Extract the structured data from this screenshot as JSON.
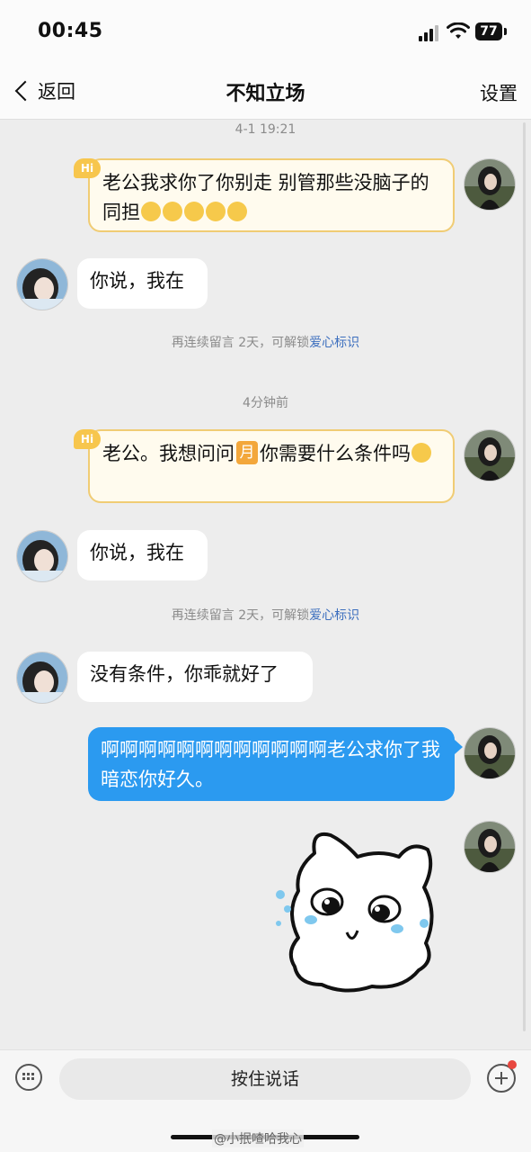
{
  "status_bar": {
    "time": "00:45",
    "battery": "77"
  },
  "navbar": {
    "back_label": "返回",
    "title": "不知立场",
    "settings_label": "设置"
  },
  "messages": [
    {
      "kind": "timestamp",
      "text": "4-1 19:21"
    },
    {
      "kind": "sent_hi",
      "text": "老公我求你了你别走 别管那些没脑子的同担",
      "emoji_count": 5,
      "hi": "Hi"
    },
    {
      "kind": "received",
      "text": "你说，我在"
    },
    {
      "kind": "notice",
      "prefix": "再连续留言 2天，可解锁",
      "link": "爱心标识"
    },
    {
      "kind": "timestamp",
      "text": "4分钟前"
    },
    {
      "kind": "sent_hi",
      "text_before": "老公。我想问问",
      "inline_badge": "月",
      "text_after": "你需要什么条件吗",
      "hi": "Hi"
    },
    {
      "kind": "received",
      "text": "你说，我在"
    },
    {
      "kind": "notice",
      "prefix": "再连续留言 2天，可解锁",
      "link": "爱心标识"
    },
    {
      "kind": "received",
      "text": "没有条件，你乖就好了"
    },
    {
      "kind": "sent",
      "text": "啊啊啊啊啊啊啊啊啊啊啊啊老公求你了我暗恋你好久。"
    },
    {
      "kind": "sticker",
      "name": "crying-cat-sticker"
    }
  ],
  "input_bar": {
    "hold_to_talk": "按住说话"
  },
  "watermark": "@小抿喳哈我心",
  "colors": {
    "sent_bubble": "#2b9af0",
    "hi_bubble_border": "#f0cc74",
    "hi_badge": "#f7c64d",
    "link": "#3d6fbe",
    "background": "#ededed"
  }
}
